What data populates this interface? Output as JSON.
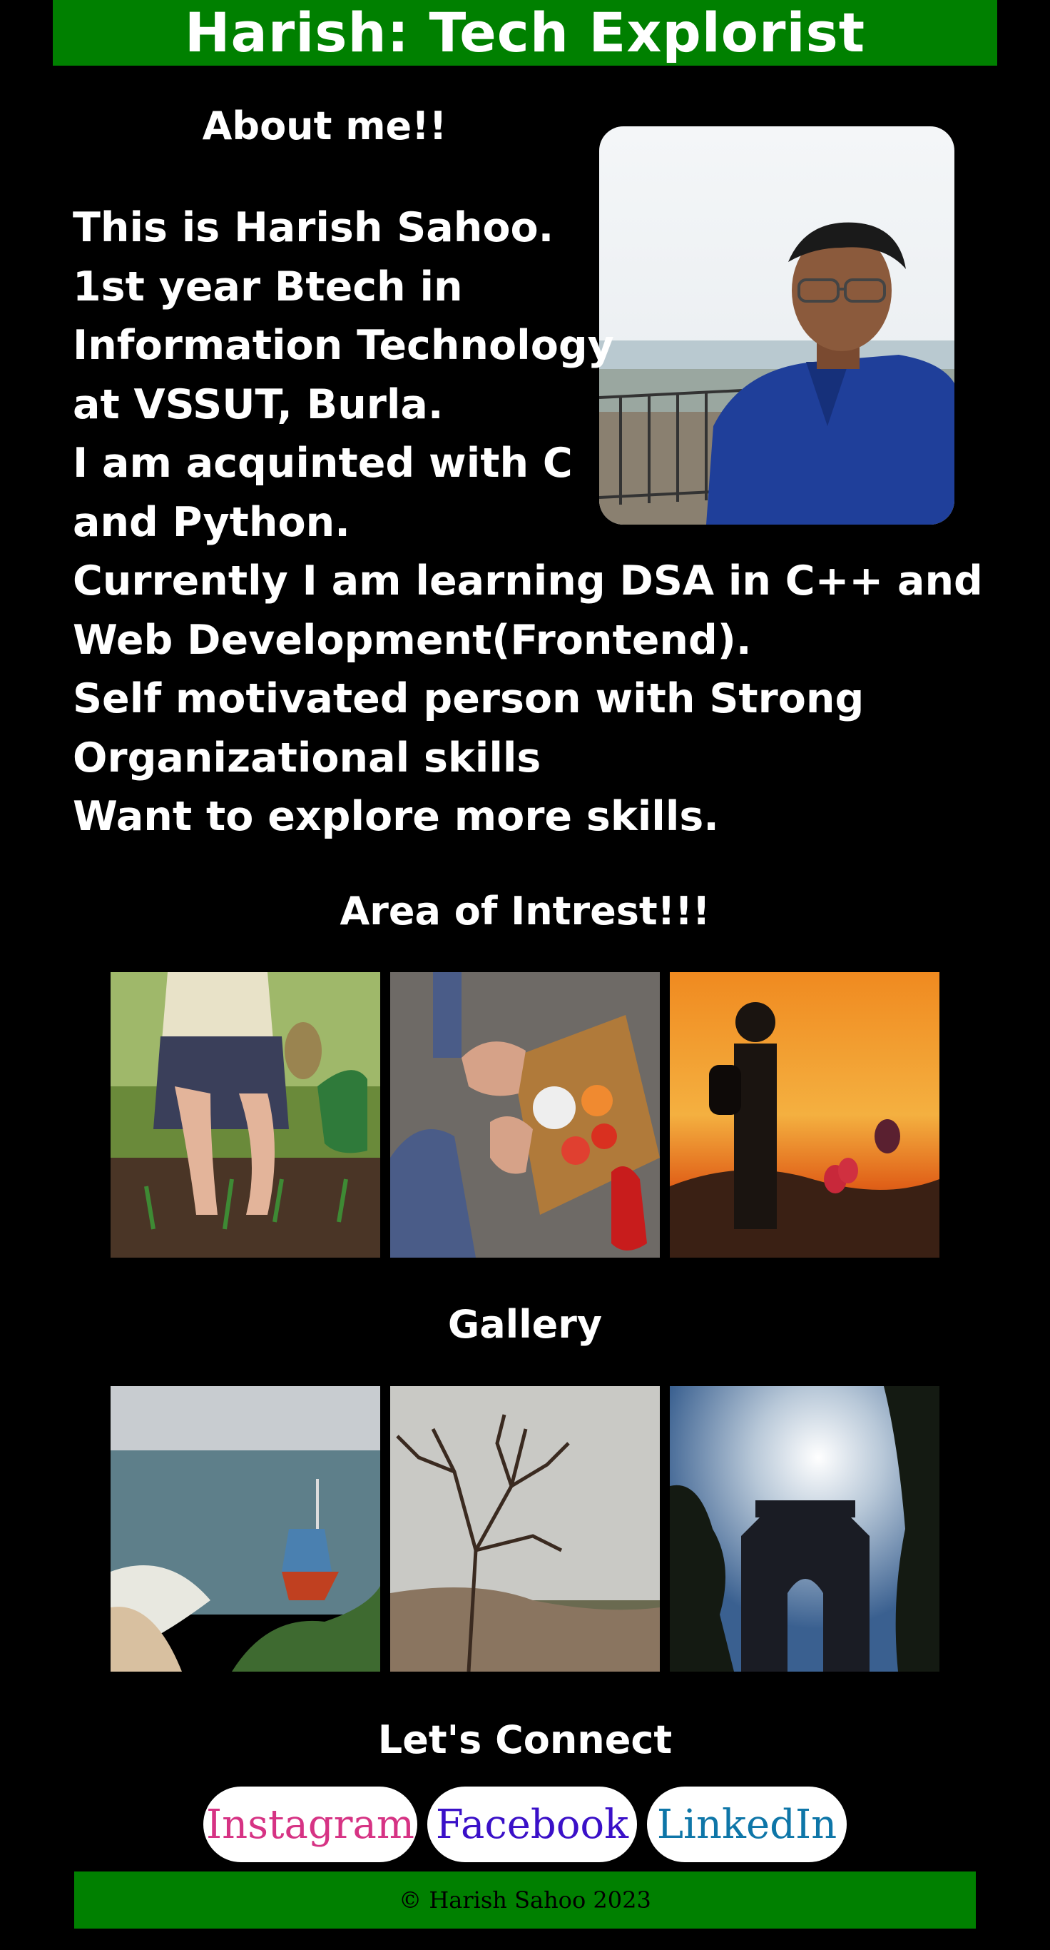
{
  "header": {
    "title": "Harish: Tech Explorist"
  },
  "about": {
    "title": "About me!!",
    "lines": [
      "This is Harish Sahoo.",
      "1st year Btech in",
      "Information Technology",
      "at VSSUT, Burla.",
      "I am acquinted with C",
      "and Python.",
      "Currently I am learning DSA in C++ and",
      "Web Development(Frontend).",
      "Self motivated person with Strong",
      "Organizational skills",
      "Want to explore more skills."
    ]
  },
  "interest": {
    "title": "Area of Intrest!!!"
  },
  "gallery": {
    "title": "Gallery"
  },
  "connect": {
    "title": "Let's Connect",
    "links": [
      {
        "label": "Instagram"
      },
      {
        "label": "Facebook"
      },
      {
        "label": "LinkedIn"
      }
    ]
  },
  "footer": {
    "text": "© Harish Sahoo 2023"
  },
  "colors": {
    "background": "#000000",
    "header_bg": "#008000",
    "instagram": "#d63384",
    "facebook": "#3a10c8",
    "linkedin": "#0e76a8"
  }
}
